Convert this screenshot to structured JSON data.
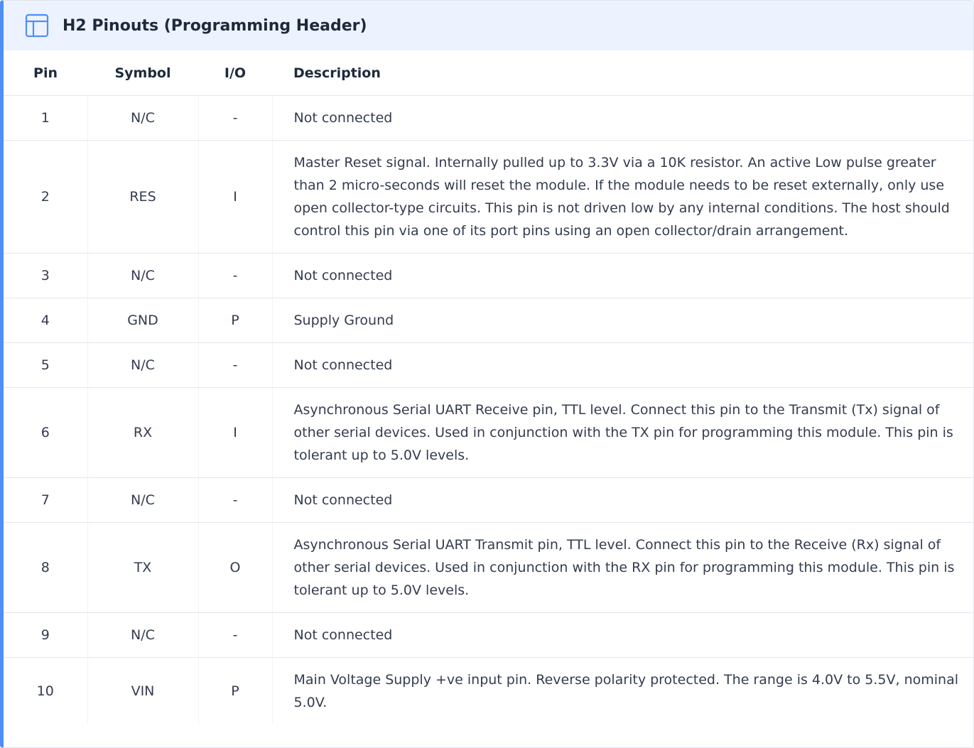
{
  "header": {
    "icon": "table-icon",
    "title": "H2 Pinouts (Programming Header)"
  },
  "columns": {
    "pin": "Pin",
    "symbol": "Symbol",
    "io": "I/O",
    "description": "Description"
  },
  "rows": [
    {
      "pin": "1",
      "symbol": "N/C",
      "io": "-",
      "description": "Not connected"
    },
    {
      "pin": "2",
      "symbol": "RES",
      "io": "I",
      "description": "Master Reset signal. Internally pulled up to 3.3V via a 10K resistor. An active Low pulse greater than 2 micro-seconds will reset the module. If the module needs to be reset externally, only use open collector-type circuits. This pin is not driven low by any internal conditions. The host should control this pin via one of its port pins using an open collector/drain arrangement."
    },
    {
      "pin": "3",
      "symbol": "N/C",
      "io": "-",
      "description": "Not connected"
    },
    {
      "pin": "4",
      "symbol": "GND",
      "io": "P",
      "description": "Supply Ground"
    },
    {
      "pin": "5",
      "symbol": "N/C",
      "io": "-",
      "description": "Not connected"
    },
    {
      "pin": "6",
      "symbol": "RX",
      "io": "I",
      "description": "Asynchronous Serial UART Receive pin, TTL level. Connect this pin to the Transmit (Tx) signal of other serial devices. Used in conjunction with the TX pin for programming this module. This pin is tolerant up to 5.0V levels."
    },
    {
      "pin": "7",
      "symbol": "N/C",
      "io": "-",
      "description": "Not connected"
    },
    {
      "pin": "8",
      "symbol": "TX",
      "io": "O",
      "description": "Asynchronous Serial UART Transmit pin, TTL level. Connect this pin to the Receive (Rx) signal of other serial devices. Used in conjunction with the RX pin for programming this module. This pin is tolerant up to 5.0V levels."
    },
    {
      "pin": "9",
      "symbol": "N/C",
      "io": "-",
      "description": "Not connected"
    },
    {
      "pin": "10",
      "symbol": "VIN",
      "io": "P",
      "description": "Main Voltage Supply +ve input pin. Reverse polarity protected. The range is 4.0V to 5.5V, nominal 5.0V."
    }
  ],
  "colors": {
    "accent": "#4f8ef7",
    "header_bg": "#ecf3ff",
    "text": "#333c4e",
    "heading": "#1e2a3b",
    "divider": "#e3e7ec"
  }
}
